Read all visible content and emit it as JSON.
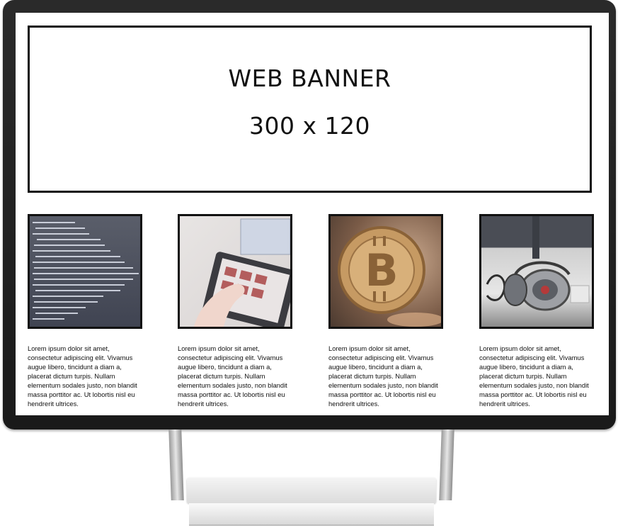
{
  "banner": {
    "title": "WEB BANNER",
    "size": "300 x 120"
  },
  "cards": [
    {
      "image": "code-screen-image",
      "text": "Lorem ipsum dolor sit amet, consectetur adipiscing elit. Vivamus augue libero, tincidunt a diam a, placerat dictum turpis. Nullam elementum sodales justo, non blandit massa porttitor ac. Ut lobortis nisl eu hendrerit ultrices."
    },
    {
      "image": "tablet-hand-image",
      "text": "Lorem ipsum dolor sit amet, consectetur adipiscing elit. Vivamus augue libero, tincidunt a diam a, placerat dictum turpis. Nullam elementum sodales justo, non blandit massa porttitor ac. Ut lobortis nisl eu hendrerit ultrices."
    },
    {
      "image": "bitcoin-image",
      "text": "Lorem ipsum dolor sit amet, consectetur adipiscing elit. Vivamus augue libero, tincidunt a diam a, placerat dictum turpis. Nullam elementum sodales justo, non blandit massa porttitor ac. Ut lobortis nisl eu hendrerit ultrices."
    },
    {
      "image": "headphones-image",
      "text": "Lorem ipsum dolor sit amet, consectetur adipiscing elit. Vivamus augue libero, tincidunt a diam a, placerat dictum turpis. Nullam elementum sodales justo, non blandit massa porttitor ac. Ut lobortis nisl eu hendrerit ultrices."
    }
  ],
  "colors": {
    "bezel": "#1f1f1f",
    "screen": "#ffffff",
    "border": "#111111"
  }
}
